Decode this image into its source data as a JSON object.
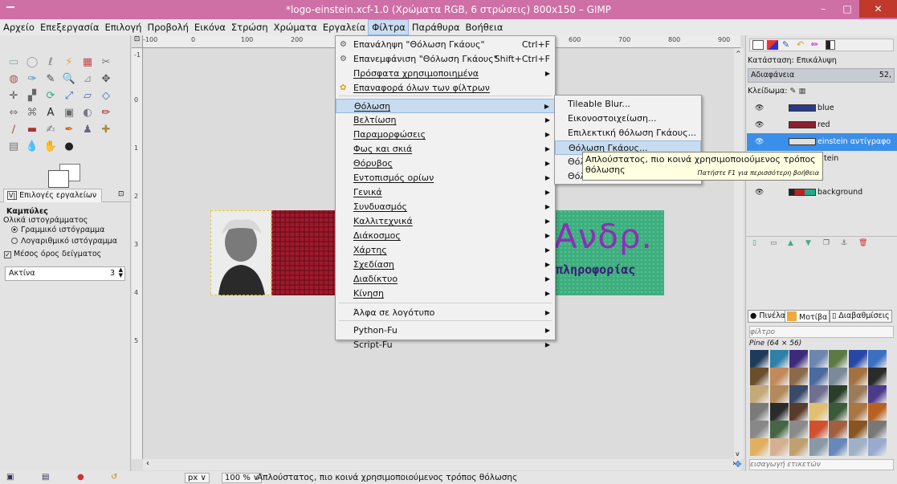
{
  "window": {
    "title": "*logo-einstein.xcf-1.0 (Χρώματα RGB, 6 στρώσεις) 800x150 – GIMP",
    "minimize": "–",
    "maximize": "□",
    "close": "✕"
  },
  "menubar": [
    "Αρχείο",
    "Επεξεργασία",
    "Επιλογή",
    "Προβολή",
    "Εικόνα",
    "Στρώση",
    "Χρώματα",
    "Εργαλεία",
    "Φίλτρα",
    "Παράθυρα",
    "Βοήθεια"
  ],
  "colors": {
    "titlebar": "#ce6fa6",
    "selection": "#3b8fe8",
    "menu_highlight": "#c8dcf0",
    "tooltip": "#ffffe1",
    "logo_text": "#8c2fb7"
  },
  "tool_options": {
    "tab": "Επιλογές εργαλείων",
    "tool_name": "Καμπύλες",
    "histogram_label": "Ολικά ιστογράμματος",
    "linear": "Γραμμικό ιστόγραμμα",
    "logarithmic": "Λογαριθμικό ιστόγραμμα",
    "sample_average": "Μέσος όρος δείγματος",
    "radius_label": "Ακτίνα",
    "radius_value": "3"
  },
  "ruler": {
    "h": [
      "-100",
      "0",
      "100",
      "200",
      "600",
      "700",
      "800",
      "900"
    ],
    "v": [
      "-1",
      "0",
      "1",
      "2",
      "3",
      "4",
      "5"
    ]
  },
  "filters_menu": {
    "items": [
      {
        "label": "Επανάληψη \"Θόλωση Γκάους\"",
        "shortcut": "Ctrl+F",
        "icon": "repeat-icon"
      },
      {
        "label": "Επανεμφάνιση \"Θόλωση Γκάους\"",
        "shortcut": "Shift+Ctrl+F",
        "icon": "reshow-icon"
      },
      {
        "label": "Πρόσφατα χρησιμοποιημένα",
        "arrow": true
      },
      {
        "label": "Επαναφορά όλων των φίλτρων",
        "icon": "reset-icon"
      },
      {
        "label": "Θόλωση",
        "arrow": true,
        "highlight": true
      },
      {
        "label": "Βελτίωση",
        "arrow": true
      },
      {
        "label": "Παραμορφώσεις",
        "arrow": true
      },
      {
        "label": "Φως και σκιά",
        "arrow": true
      },
      {
        "label": "Θόρυβος",
        "arrow": true
      },
      {
        "label": "Εντοπισμός ορίων",
        "arrow": true
      },
      {
        "label": "Γενικά",
        "arrow": true
      },
      {
        "label": "Συνδυασμός",
        "arrow": true
      },
      {
        "label": "Καλλιτεχνικά",
        "arrow": true
      },
      {
        "label": "Διάκοσμος",
        "arrow": true
      },
      {
        "label": "Χάρτης",
        "arrow": true
      },
      {
        "label": "Σχεδίαση",
        "arrow": true
      },
      {
        "label": "Διαδίκτυο",
        "arrow": true
      },
      {
        "label": "Κίνηση",
        "arrow": true
      },
      {
        "label": "Άλφα σε λογότυπο",
        "arrow": true
      },
      {
        "label": "Python-Fu",
        "arrow": true
      },
      {
        "label": "Script-Fu",
        "arrow": true
      }
    ]
  },
  "blur_submenu": {
    "items": [
      "Tileable Blur...",
      "Εικονοστοιχείωση...",
      "Επιλεκτική θόλωση Γκάους...",
      "Θόλωση Γκάους...",
      "Θόλ",
      "Θόλ"
    ]
  },
  "tooltip": {
    "text": "Απλούστατος, πιο κοινά χρησιμοποιούμενος τρόπος θόλωσης",
    "hint": "Πατήστε F1 για περισσότερη βοήθεια"
  },
  "image": {
    "logo_text": "Ανδρ.",
    "sub_text": "πληροφορίας"
  },
  "status": {
    "unit": "px",
    "zoom": "100 %",
    "message": "Απλούστατος, πιο κοινά χρησιμοποιούμενος τρόπος θόλωσης"
  },
  "layers": {
    "mode_label": "Κατάσταση: Επικάλυψη",
    "opacity_label": "Αδιαφάνεια",
    "opacity_value": "52,",
    "lock_label": "Κλείδωμα:",
    "items": [
      {
        "name": "blue"
      },
      {
        "name": "red"
      },
      {
        "name": "einstein αντίγραφο"
      },
      {
        "name": "tein"
      },
      {
        "name": ""
      },
      {
        "name": "background"
      }
    ]
  },
  "patterns": {
    "tabs": [
      "Πινέλα",
      "Μοτίβα",
      "Διαβαθμίσεις"
    ],
    "filter_placeholder": "φίλτρο",
    "current": "Pine (64 × 56)",
    "tags_placeholder": "εισαγωγή ετικετών"
  }
}
